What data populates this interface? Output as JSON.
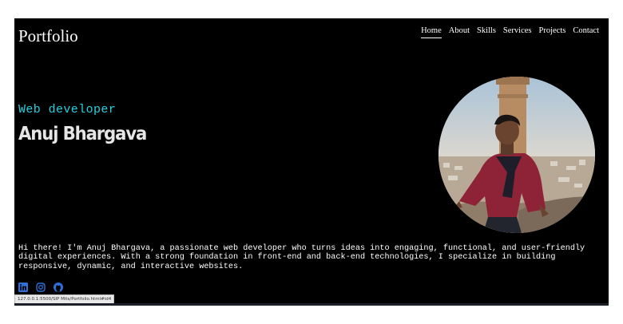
{
  "header": {
    "brand": "Portfolio",
    "nav": [
      {
        "label": "Home",
        "active": true
      },
      {
        "label": "About"
      },
      {
        "label": "Skills"
      },
      {
        "label": "Services"
      },
      {
        "label": "Projects"
      },
      {
        "label": "Contact"
      }
    ]
  },
  "hero": {
    "role": "Web developer",
    "name": "Anuj Bhargava",
    "intro": "Hi there! I'm Anuj Bhargava, a passionate web developer who turns ideas into engaging, functional, and user-friendly digital experiences. With a strong foundation in front-end and back-end technologies, I specialize in building responsive, dynamic, and interactive websites."
  },
  "socials": [
    {
      "icon": "linkedin-icon"
    },
    {
      "icon": "instagram-icon"
    },
    {
      "icon": "github-icon"
    }
  ],
  "status_url": "127.0.0.1:5500/SIP Mits/Portfolio.html#id4",
  "colors": {
    "accent": "#21d3e0",
    "background": "#000000",
    "icon": "#2f6fd8"
  }
}
